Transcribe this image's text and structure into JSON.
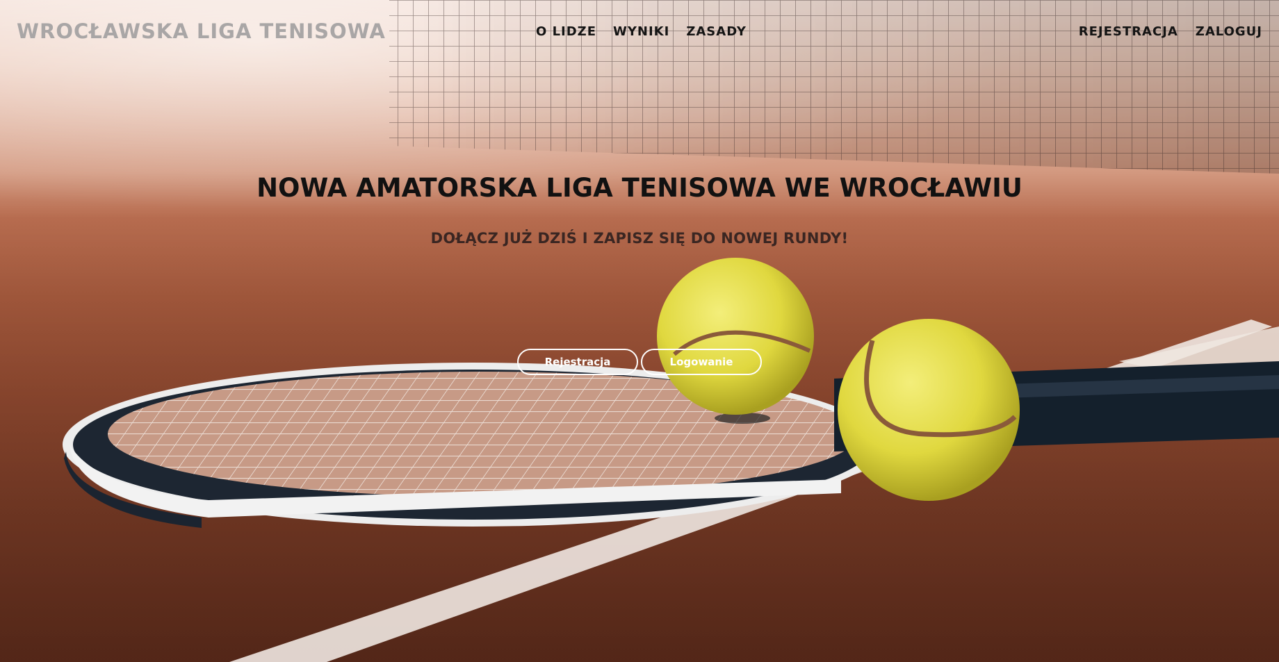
{
  "brand": {
    "title": "WROCŁAWSKA LIGA TENISOWA"
  },
  "nav": {
    "center": [
      "O LIDZE",
      "WYNIKI",
      "ZASADY"
    ],
    "right": [
      "REJESTRACJA",
      "ZALOGUJ"
    ]
  },
  "hero": {
    "headline": "NOWA AMATORSKA LIGA TENISOWA WE WROCŁAWIU",
    "subline": "DOŁĄCZ JUŻ DZIŚ I ZAPISZ SIĘ DO NOWEJ RUNDY!",
    "buttons": {
      "register": "Rejestracja",
      "login": "Logowanie"
    }
  },
  "colors": {
    "clay": "#944b31",
    "brand_text": "#a9a6a6",
    "nav_text": "#141414",
    "ball": "#e3df45"
  },
  "icons": [
    "tennis-racket-image",
    "tennis-ball-image",
    "tennis-net-image"
  ]
}
